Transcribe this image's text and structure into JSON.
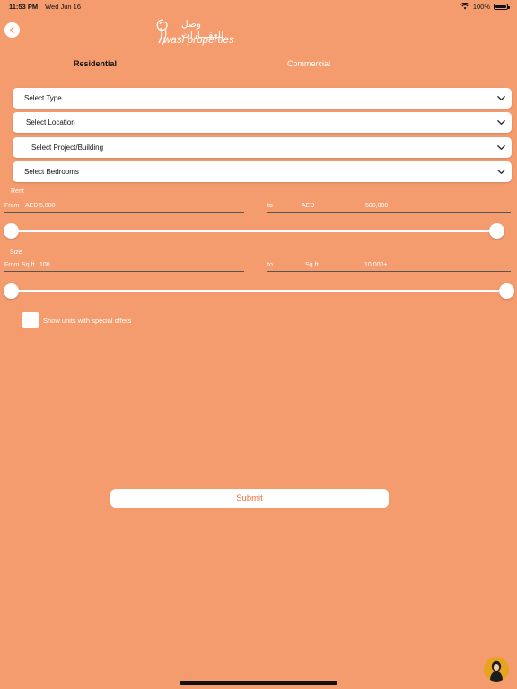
{
  "status_bar": {
    "time": "11:53 PM",
    "date": "Wed Jun 16",
    "battery": "100%",
    "battery_level": 1.0
  },
  "logo": {
    "arabic": "وصل للعقـــارات",
    "english": "wasl properties"
  },
  "tabs": [
    {
      "label": "Residential",
      "selected": true
    },
    {
      "label": "Commercial",
      "selected": false
    }
  ],
  "dropdowns": {
    "type": "Select Type",
    "location": "Select Location",
    "project": "Select Project/Building",
    "bedrooms": "Select Bedrooms"
  },
  "rent": {
    "label": "Rent",
    "from_label": "From",
    "from_unit": "AED",
    "from_value": "5,000",
    "to_label": "to",
    "to_unit": "AED",
    "to_value": "500,000+",
    "slider_min": 0.0,
    "slider_max": 1.0
  },
  "size": {
    "label": "Size",
    "from_label": "From",
    "from_unit": "Sq.ft",
    "from_value": "100",
    "to_label": "to",
    "to_unit": "Sq.ft",
    "to_value": "10,000+",
    "slider_min": 0.0,
    "slider_max": 1.0
  },
  "special_offers": {
    "label": "Show units with special offers",
    "checked": false
  },
  "submit_label": "Submit",
  "colors": {
    "background": "#F59C6F",
    "accent": "#E86C3A",
    "avatar": "#E8A420"
  },
  "icons": {
    "back": "chevron-left-icon",
    "dropdown": "chevron-down-icon",
    "wifi": "wifi-icon",
    "battery": "battery-icon",
    "chat": "assistant-avatar-icon"
  }
}
